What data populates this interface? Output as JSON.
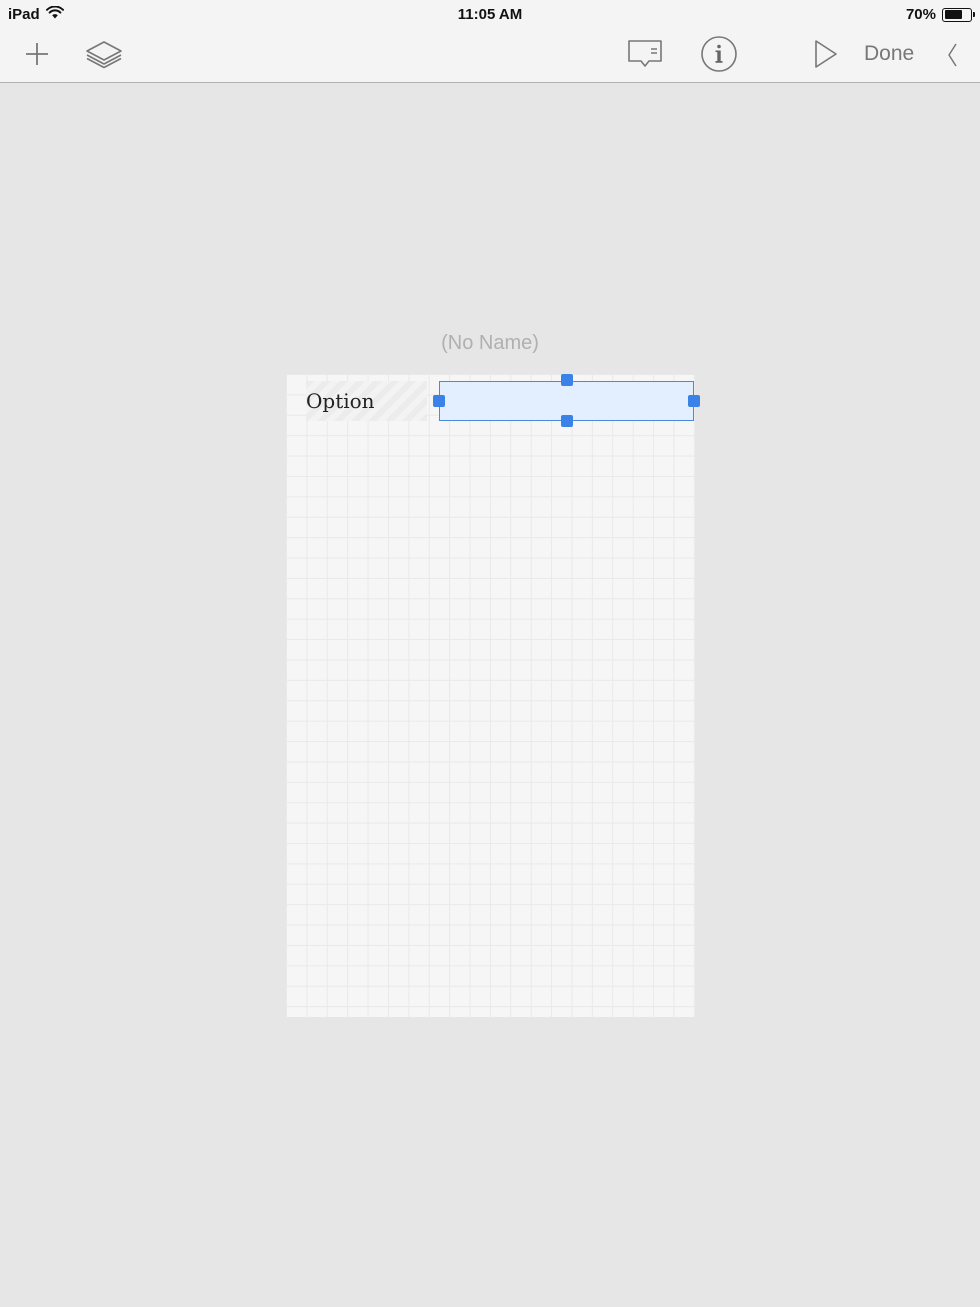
{
  "status_bar": {
    "carrier": "iPad",
    "time": "11:05 AM",
    "battery_percent": "70%",
    "battery_level": 0.7
  },
  "toolbar": {
    "add_icon": "plus-icon",
    "layers_icon": "layers-icon",
    "comment_icon": "comment-icon",
    "info_icon": "info-icon",
    "play_icon": "play-icon",
    "done_label": "Done",
    "collapse_icon": "chevron-left-icon"
  },
  "document": {
    "title": "(No Name)"
  },
  "form": {
    "label": "Option",
    "field_value": ""
  },
  "colors": {
    "selection": "#3b82e8",
    "field_fill": "#e3efff"
  }
}
